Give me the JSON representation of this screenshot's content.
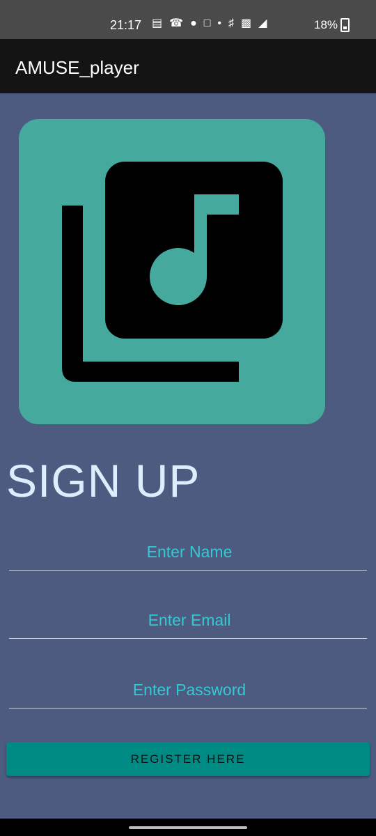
{
  "status_bar": {
    "time": "21:17",
    "icons": [
      "message-icon",
      "missed-call-icon",
      "chat-bubble-icon",
      "instagram-icon",
      "dot-icon",
      "mute-icon",
      "volte-icon",
      "signal-4g-icon"
    ],
    "battery": "18%"
  },
  "app_bar": {
    "title": "AMUSE_player"
  },
  "logo": {
    "icon": "music-library-icon",
    "background": "#45a99e"
  },
  "page": {
    "title": "SIGN UP",
    "name_placeholder": "Enter Name",
    "email_placeholder": "Enter Email",
    "password_placeholder": "Enter Password",
    "register_label": "REGISTER HERE"
  },
  "colors": {
    "background": "#4d5b80",
    "accent": "#34c9d2",
    "button": "#008a84"
  }
}
